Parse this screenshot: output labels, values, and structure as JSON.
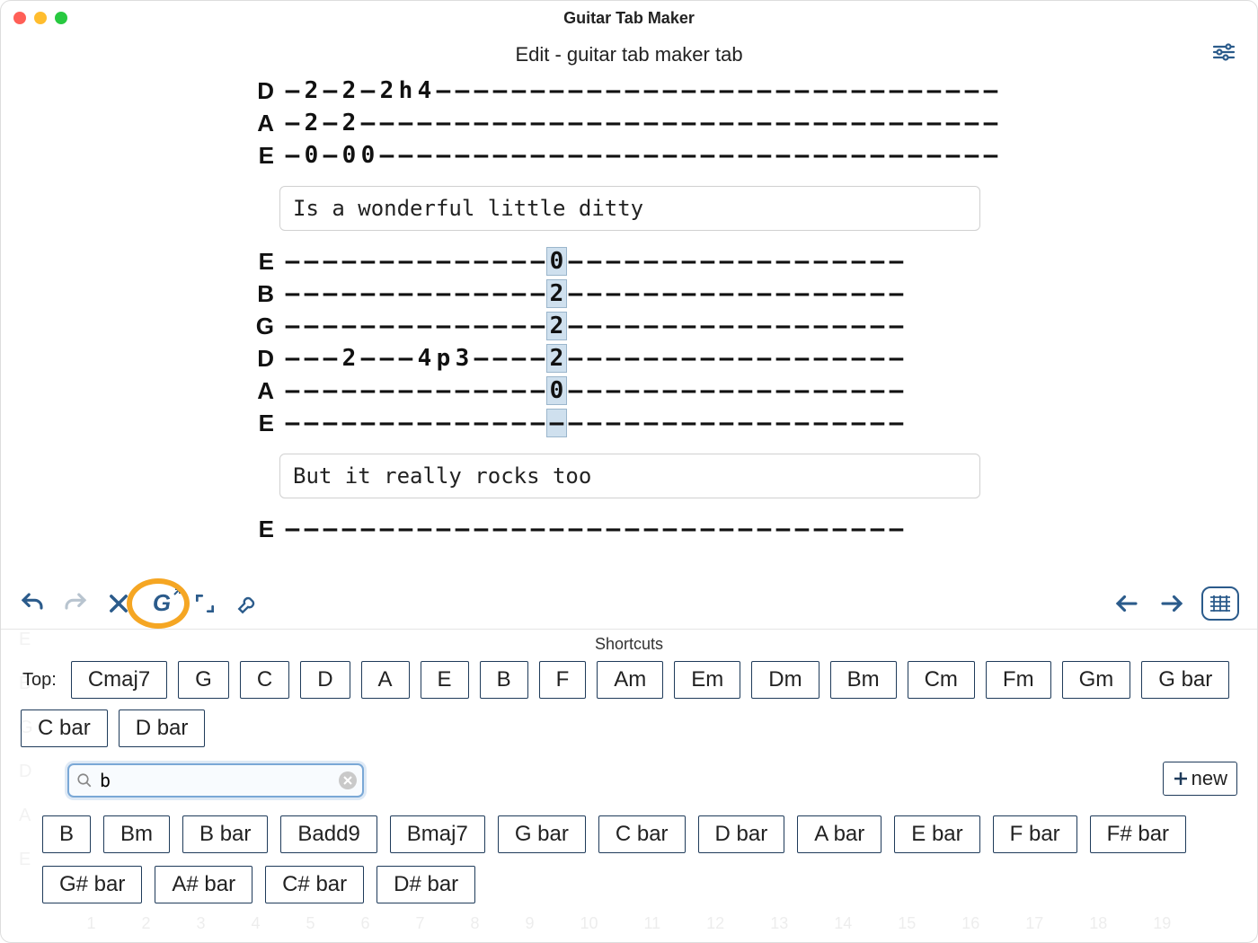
{
  "app": {
    "title": "Guitar Tab Maker"
  },
  "subheader": {
    "title": "Edit - guitar tab maker tab"
  },
  "tab1": {
    "strings": [
      "D",
      "A",
      "E"
    ],
    "D": [
      "—",
      "2",
      "—",
      "2",
      "—",
      "2",
      "h",
      "4",
      "—",
      "—",
      "—",
      "—",
      "—",
      "—",
      "—",
      "—",
      "—",
      "—",
      "—",
      "—",
      "—",
      "—",
      "—",
      "—",
      "—",
      "—",
      "—",
      "—",
      "—",
      "—",
      "—",
      "—",
      "—",
      "—",
      "—",
      "—",
      "—",
      "—"
    ],
    "A": [
      "—",
      "2",
      "—",
      "2",
      "—",
      "—",
      "—",
      "—",
      "—",
      "—",
      "—",
      "—",
      "—",
      "—",
      "—",
      "—",
      "—",
      "—",
      "—",
      "—",
      "—",
      "—",
      "—",
      "—",
      "—",
      "—",
      "—",
      "—",
      "—",
      "—",
      "—",
      "—",
      "—",
      "—",
      "—",
      "—",
      "—",
      "—"
    ],
    "E": [
      "—",
      "0",
      "—",
      "0",
      "0",
      "—",
      "—",
      "—",
      "—",
      "—",
      "—",
      "—",
      "—",
      "—",
      "—",
      "—",
      "—",
      "—",
      "—",
      "—",
      "—",
      "—",
      "—",
      "—",
      "—",
      "—",
      "—",
      "—",
      "—",
      "—",
      "—",
      "—",
      "—",
      "—",
      "—",
      "—",
      "—",
      "—"
    ]
  },
  "lyric1": "Is a wonderful little ditty",
  "tab2": {
    "strings": [
      "E",
      "B",
      "G",
      "D",
      "A",
      "E"
    ],
    "highlight_col": 14,
    "E1": [
      "—",
      "—",
      "—",
      "—",
      "—",
      "—",
      "—",
      "—",
      "—",
      "—",
      "—",
      "—",
      "—",
      "—",
      "0",
      "—",
      "—",
      "—",
      "—",
      "—",
      "—",
      "—",
      "—",
      "—",
      "—",
      "—",
      "—",
      "—",
      "—",
      "—",
      "—",
      "—",
      "—"
    ],
    "B": [
      "—",
      "—",
      "—",
      "—",
      "—",
      "—",
      "—",
      "—",
      "—",
      "—",
      "—",
      "—",
      "—",
      "—",
      "2",
      "—",
      "—",
      "—",
      "—",
      "—",
      "—",
      "—",
      "—",
      "—",
      "—",
      "—",
      "—",
      "—",
      "—",
      "—",
      "—",
      "—",
      "—"
    ],
    "G": [
      "—",
      "—",
      "—",
      "—",
      "—",
      "—",
      "—",
      "—",
      "—",
      "—",
      "—",
      "—",
      "—",
      "—",
      "2",
      "—",
      "—",
      "—",
      "—",
      "—",
      "—",
      "—",
      "—",
      "—",
      "—",
      "—",
      "—",
      "—",
      "—",
      "—",
      "—",
      "—",
      "—"
    ],
    "D": [
      "—",
      "—",
      "—",
      "2",
      "—",
      "—",
      "—",
      "4",
      "p",
      "3",
      "—",
      "—",
      "—",
      "—",
      "2",
      "—",
      "—",
      "—",
      "—",
      "—",
      "—",
      "—",
      "—",
      "—",
      "—",
      "—",
      "—",
      "—",
      "—",
      "—",
      "—",
      "—",
      "—"
    ],
    "A": [
      "—",
      "—",
      "—",
      "—",
      "—",
      "—",
      "—",
      "—",
      "—",
      "—",
      "—",
      "—",
      "—",
      "—",
      "0",
      "—",
      "—",
      "—",
      "—",
      "—",
      "—",
      "—",
      "—",
      "—",
      "—",
      "—",
      "—",
      "—",
      "—",
      "—",
      "—",
      "—",
      "—"
    ],
    "E2": [
      "—",
      "—",
      "—",
      "—",
      "—",
      "—",
      "—",
      "—",
      "—",
      "—",
      "—",
      "—",
      "—",
      "—",
      "—",
      "—",
      "—",
      "—",
      "—",
      "—",
      "—",
      "—",
      "—",
      "—",
      "—",
      "—",
      "—",
      "—",
      "—",
      "—",
      "—",
      "—",
      "—"
    ]
  },
  "lyric2": "But it really rocks too",
  "tab3": {
    "string": "E",
    "cells": [
      "—",
      "—",
      "—",
      "—",
      "—",
      "—",
      "—",
      "—",
      "—",
      "—",
      "—",
      "—",
      "—",
      "—",
      "—",
      "—",
      "—",
      "—",
      "—",
      "—",
      "—",
      "—",
      "—",
      "—",
      "—",
      "—",
      "—",
      "—",
      "—",
      "—",
      "—",
      "—",
      "—"
    ]
  },
  "shortcuts": {
    "title": "Shortcuts",
    "top_label": "Top:",
    "top": [
      "Cmaj7",
      "G",
      "C",
      "D",
      "A",
      "E",
      "B",
      "F",
      "Am",
      "Em",
      "Dm",
      "Bm",
      "Cm",
      "Fm",
      "Gm",
      "G bar",
      "C bar",
      "D bar"
    ],
    "search": {
      "value": "b",
      "placeholder": ""
    },
    "new_label": "new",
    "results": [
      "B",
      "Bm",
      "B bar",
      "Badd9",
      "Bmaj7",
      "G bar",
      "C bar",
      "D bar",
      "A bar",
      "E bar",
      "F bar",
      "F# bar",
      "G# bar",
      "A# bar",
      "C# bar",
      "D# bar"
    ]
  },
  "bg_numbers": [
    "1",
    "2",
    "3",
    "4",
    "5",
    "6",
    "7",
    "8",
    "9",
    "10",
    "11",
    "12",
    "13",
    "14",
    "15",
    "16",
    "17",
    "18",
    "19"
  ],
  "bg_strings": [
    "E",
    "B",
    "G",
    "D",
    "A",
    "E"
  ]
}
